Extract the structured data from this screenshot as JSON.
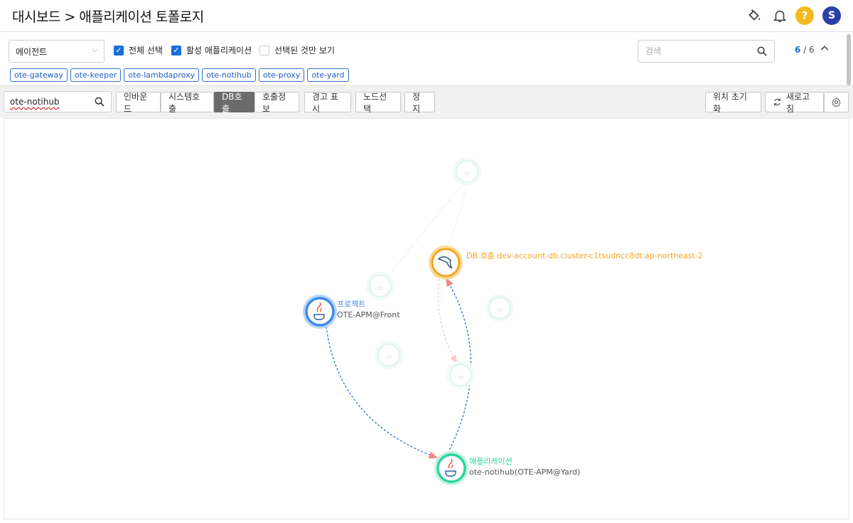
{
  "header": {
    "title": "대시보드 > 애플리케이션 토폴로지",
    "avatar_initial": "S",
    "help_glyph": "?"
  },
  "filter": {
    "agent_select": "에이전트",
    "check_all": {
      "label": "전체 선택",
      "checked": true
    },
    "check_active": {
      "label": "활성 애플리케이션",
      "checked": true
    },
    "check_selected_only": {
      "label": "선택된 것만 보기",
      "checked": false
    },
    "search_placeholder": "검색",
    "pager_current": "6",
    "pager_total": "/ 6",
    "tags": [
      "ote-gateway",
      "ote-keeper",
      "ote-lambdaproxy",
      "ote-notihub",
      "ote-proxy",
      "ote-yard"
    ]
  },
  "toolbar": {
    "node_search_value": "ote-notihub",
    "buttons": [
      "인바운드",
      "시스템호출",
      "DB호출",
      "호출정보",
      "경고 표시",
      "노드선택",
      "정지"
    ],
    "active_button": "DB호출",
    "reset_position": "위치 초기화",
    "refresh": "새로고침"
  },
  "topology": {
    "colors": {
      "blue": "#3d8be8",
      "orange": "#f5a623",
      "green": "#2ed3a0",
      "faded": "#d6f5ea",
      "edge": "#2f6fd6",
      "arrow": "#f08a8a"
    },
    "nodes": {
      "project": {
        "type": "프로젝트",
        "name": "OTE-APM@Front",
        "icon": "java-icon"
      },
      "db": {
        "label": "DB 호출 dev-account-db.cluster-c1tsudncc8dt.ap-northeast-2",
        "icon": "mysql-dolphin-icon"
      },
      "app": {
        "type": "애플리케이션",
        "name": "ote-notihub(OTE-APM@Yard)",
        "icon": "java-icon"
      }
    }
  }
}
